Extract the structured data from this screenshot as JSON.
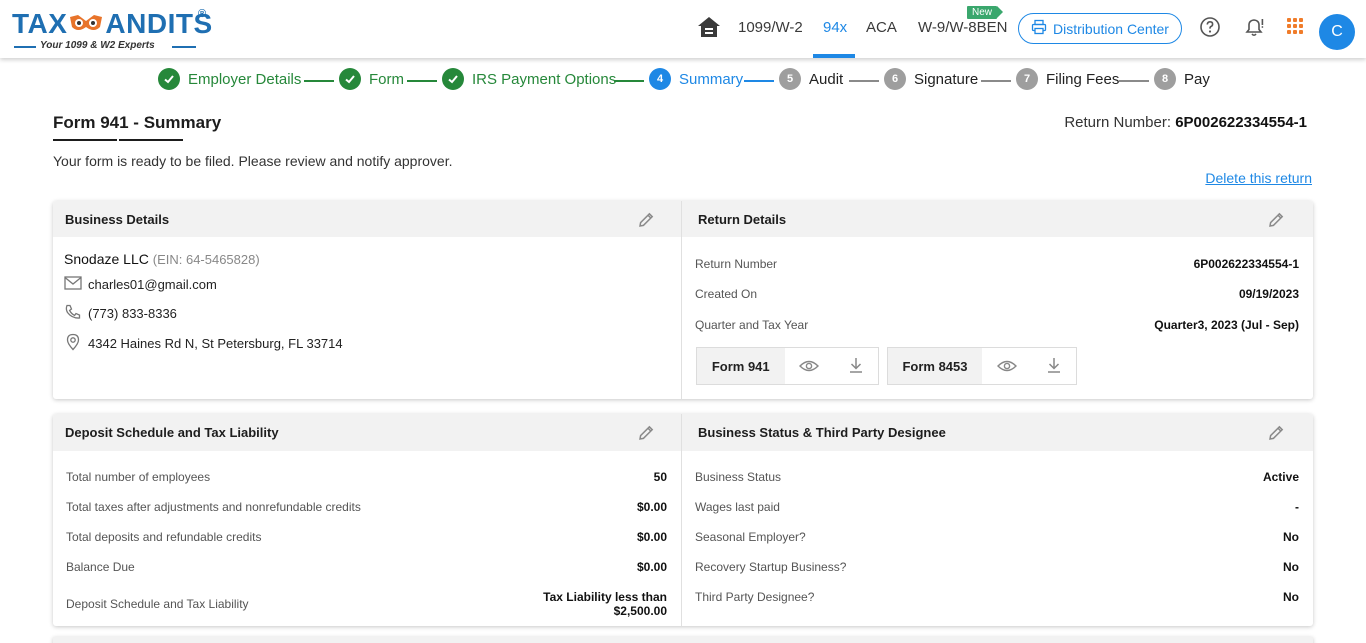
{
  "brand": {
    "logo_text_left": "TAX",
    "logo_text_right": "ANDITS",
    "trademark": "®",
    "tagline": "Your 1099 & W2 Experts"
  },
  "nav": {
    "items": [
      {
        "label": "1099/W-2",
        "active": false
      },
      {
        "label": "94x",
        "active": true
      },
      {
        "label": "ACA",
        "active": false
      },
      {
        "label": "W-9/W-8BEN",
        "active": false
      }
    ],
    "new_badge": "New",
    "distribution_center": "Distribution Center",
    "avatar_initial": "C",
    "accent_color": "#1e88e5",
    "icons": [
      "home-icon",
      "printer-icon",
      "help-icon",
      "bell-icon",
      "apps-grid-icon"
    ]
  },
  "stepper": {
    "steps": [
      {
        "number": "1",
        "label": "Employer Details",
        "state": "done"
      },
      {
        "number": "2",
        "label": "Form",
        "state": "done"
      },
      {
        "number": "3",
        "label": "IRS Payment Options",
        "state": "done"
      },
      {
        "number": "4",
        "label": "Summary",
        "state": "current"
      },
      {
        "number": "5",
        "label": "Audit",
        "state": "todo"
      },
      {
        "number": "6",
        "label": "Signature",
        "state": "todo"
      },
      {
        "number": "7",
        "label": "Filing Fees",
        "state": "todo"
      },
      {
        "number": "8",
        "label": "Pay",
        "state": "todo"
      }
    ],
    "colors": {
      "done": "#26883a",
      "current": "#1e88e5",
      "todo": "#9e9e9e"
    }
  },
  "page": {
    "title": "Form 941 - Summary",
    "return_number_label": "Return Number:",
    "return_number": "6P002622334554-1",
    "subtitle": "Your form is ready to be filed. Please review and notify approver.",
    "delete_link": "Delete this return"
  },
  "business_details": {
    "heading": "Business Details",
    "name": "Snodaze LLC",
    "ein": "(EIN: 64-5465828)",
    "email": "charles01@gmail.com",
    "phone": "(773) 833-8336",
    "address": "4342 Haines Rd N, St Petersburg, FL 33714"
  },
  "return_details": {
    "heading": "Return Details",
    "rows": [
      {
        "label": "Return Number",
        "value": "6P002622334554-1"
      },
      {
        "label": "Created On",
        "value": "09/19/2023"
      },
      {
        "label": "Quarter and Tax Year",
        "value": "Quarter3, 2023 (Jul - Sep)"
      }
    ],
    "forms": [
      {
        "name": "Form 941"
      },
      {
        "name": "Form 8453"
      }
    ]
  },
  "deposit_schedule": {
    "heading": "Deposit Schedule and Tax Liability",
    "rows": [
      {
        "label": "Total number of employees",
        "value": "50"
      },
      {
        "label": "Total taxes after adjustments and nonrefundable credits",
        "value": "$0.00"
      },
      {
        "label": "Total deposits and refundable credits",
        "value": "$0.00"
      },
      {
        "label": "Balance Due",
        "value": "$0.00"
      },
      {
        "label": "Deposit Schedule and Tax Liability",
        "value_line1": "Tax Liability less than",
        "value_line2": "$2,500.00"
      }
    ]
  },
  "business_status": {
    "heading": "Business Status & Third Party Designee",
    "rows": [
      {
        "label": "Business Status",
        "value": "Active"
      },
      {
        "label": "Wages last paid",
        "value": "-"
      },
      {
        "label": "Seasonal Employer?",
        "value": "No"
      },
      {
        "label": "Recovery Startup Business?",
        "value": "No"
      },
      {
        "label": "Third Party Designee?",
        "value": "No"
      }
    ]
  }
}
